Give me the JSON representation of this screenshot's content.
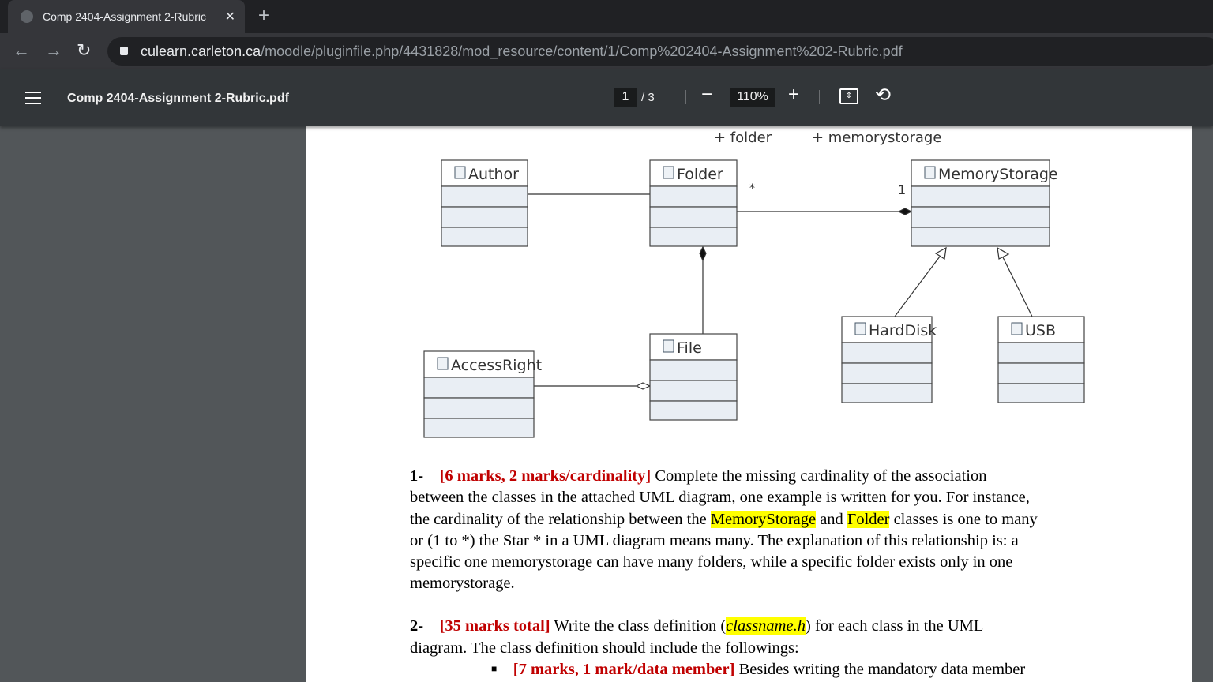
{
  "browser": {
    "tab_title": "Comp 2404-Assignment 2-Rubric",
    "url_host": "culearn.carleton.ca",
    "url_path": "/moodle/pluginfile.php/4431828/mod_resource/content/1/Comp%202404-Assignment%202-Rubric.pdf"
  },
  "viewer": {
    "title": "Comp 2404-Assignment 2-Rubric.pdf",
    "page": "1",
    "page_total": "/  3",
    "zoom": "110%"
  },
  "diagram": {
    "top_labels": [
      "+ folder",
      "+ memorystorage"
    ],
    "classes": {
      "author": "Author",
      "folder": "Folder",
      "memory": "MemoryStorage",
      "file": "File",
      "access": "AccessRight",
      "harddisk": "HardDisk",
      "usb": "USB"
    },
    "mult_star": "*",
    "mult_one": "1"
  },
  "q1": {
    "num": "1-",
    "marks": "[6 marks, 2 marks/cardinality]",
    "l1": " Complete the missing cardinality of the association",
    "l2": "between the classes in the attached UML diagram, one example is written for you. For instance,",
    "l3a": "the cardinality of the relationship between the ",
    "hl1": "MemoryStorage",
    "l3b": " and ",
    "hl2": "Folder",
    "l3c": " classes is one to many",
    "l4": "or (1 to *) the Star * in a UML diagram means many. The explanation of this relationship is: a",
    "l5": "specific one  memorystorage can have many folders, while a specific folder exists only in one",
    "l6": "memorystorage."
  },
  "q2": {
    "num": "2-",
    "marks": "[35 marks total]",
    "l1a": " Write the class definition (",
    "hl": "classname.h",
    "l1b": ") for each class in the UML",
    "l2": "diagram. The class definition should include the followings:",
    "bullet_marks": "[7 marks, 1 mark/data member]",
    "bullet_text": " Besides writing the mandatory data member"
  }
}
